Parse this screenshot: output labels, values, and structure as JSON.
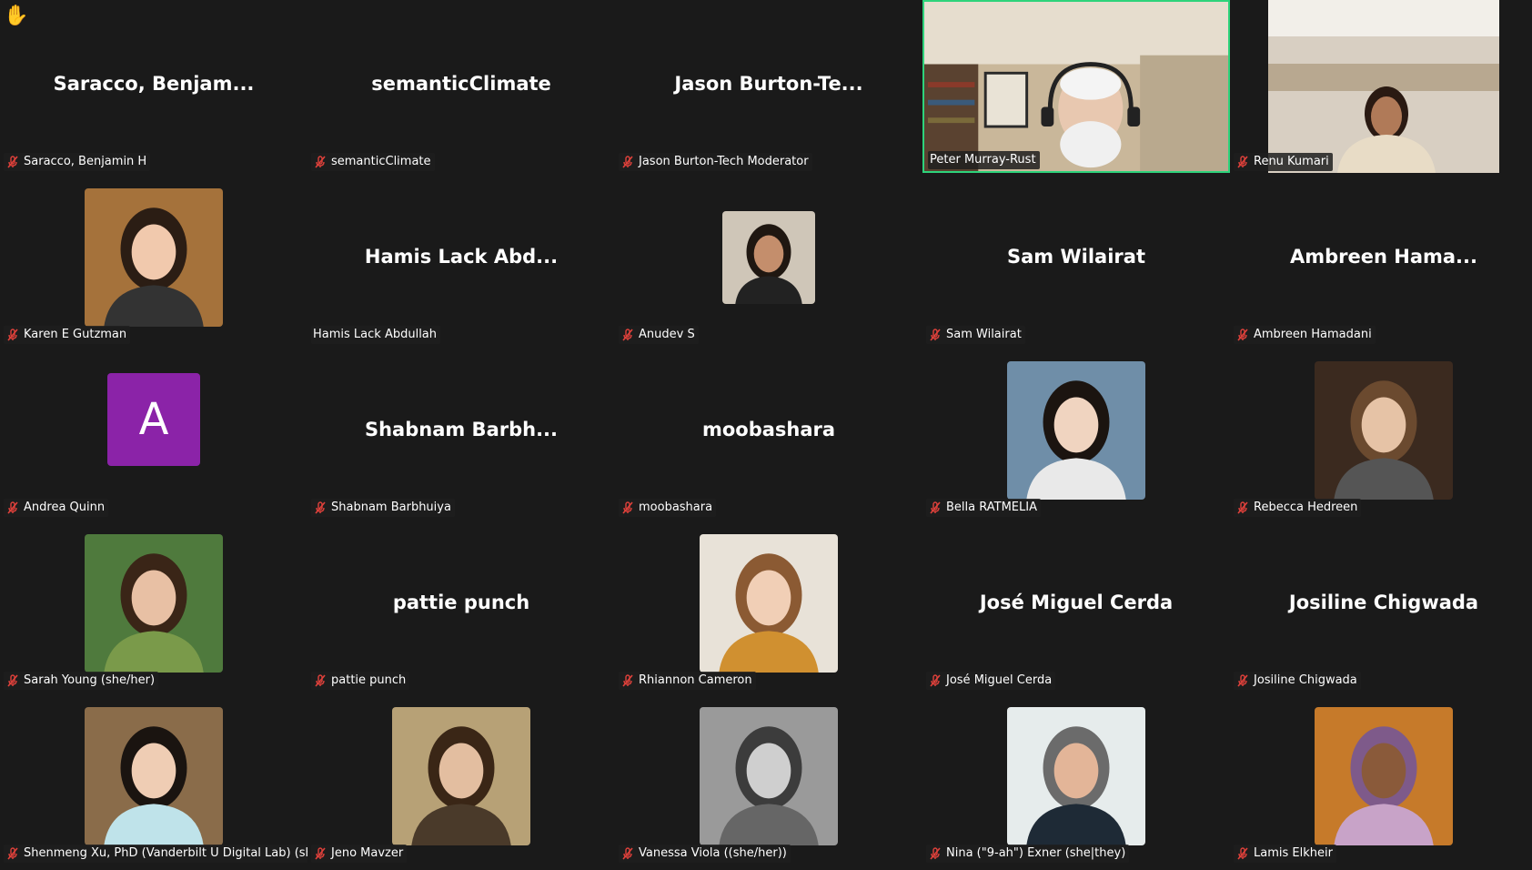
{
  "reaction": {
    "icon": "raise-hand-icon",
    "glyph": "✋"
  },
  "participants": [
    {
      "name": "Saracco, Benjamin H",
      "display": "Saracco,  Benjam...",
      "muted": true,
      "view": "name"
    },
    {
      "name": "semanticClimate",
      "display": "semanticClimate",
      "muted": true,
      "view": "name"
    },
    {
      "name": "Jason Burton-Tech Moderator",
      "display": "Jason  Burton-Te...",
      "muted": true,
      "view": "name"
    },
    {
      "name": "Peter Murray-Rust",
      "muted": false,
      "view": "video",
      "active_speaker": true
    },
    {
      "name": "Renu Kumari",
      "muted": true,
      "view": "video"
    },
    {
      "name": "Karen E Gutzman",
      "muted": true,
      "view": "photo"
    },
    {
      "name": "Hamis Lack Abdullah",
      "display": "Hamis Lack Abd...",
      "muted": false,
      "view": "name"
    },
    {
      "name": "Anudev S",
      "muted": true,
      "view": "photo"
    },
    {
      "name": "Sam Wilairat",
      "display": "Sam Wilairat",
      "muted": true,
      "view": "name"
    },
    {
      "name": "Ambreen Hamadani",
      "display": "Ambreen  Hama...",
      "muted": true,
      "view": "name"
    },
    {
      "name": "Andrea Quinn",
      "letter": "A",
      "muted": true,
      "view": "letter"
    },
    {
      "name": "Shabnam Barbhuiya",
      "display": "Shabnam  Barbh...",
      "muted": true,
      "view": "name"
    },
    {
      "name": "moobashara",
      "display": "moobashara",
      "muted": true,
      "view": "name"
    },
    {
      "name": "Bella RATMELIA",
      "muted": true,
      "view": "photo"
    },
    {
      "name": "Rebecca Hedreen",
      "muted": true,
      "view": "photo"
    },
    {
      "name": "Sarah Young (she/her)",
      "muted": true,
      "view": "photo"
    },
    {
      "name": "pattie punch",
      "display": "pattie punch",
      "muted": true,
      "view": "name"
    },
    {
      "name": "Rhiannon Cameron",
      "muted": true,
      "view": "photo"
    },
    {
      "name": "José Miguel Cerda",
      "display": "José Miguel Cerda",
      "muted": true,
      "view": "name"
    },
    {
      "name": "Josiline Chigwada",
      "display": "Josiline Chigwada",
      "muted": true,
      "view": "name"
    },
    {
      "name": "Shenmeng Xu, PhD (Vanderbilt U Digital Lab) (sh...",
      "muted": true,
      "view": "photo"
    },
    {
      "name": "Jeno Mavzer",
      "muted": true,
      "view": "photo"
    },
    {
      "name": "Vanessa Viola ((she/her))",
      "muted": true,
      "view": "photo"
    },
    {
      "name": "Nina (\"9-ah\") Exner (she|they)",
      "muted": true,
      "view": "photo"
    },
    {
      "name": "Lamis Elkheir",
      "muted": true,
      "view": "photo"
    }
  ],
  "colors": {
    "background": "#1a1a1a",
    "active_speaker_border": "#2ed37b",
    "muted_icon": "#e0413b",
    "letter_avatar": "#8b23a8"
  }
}
